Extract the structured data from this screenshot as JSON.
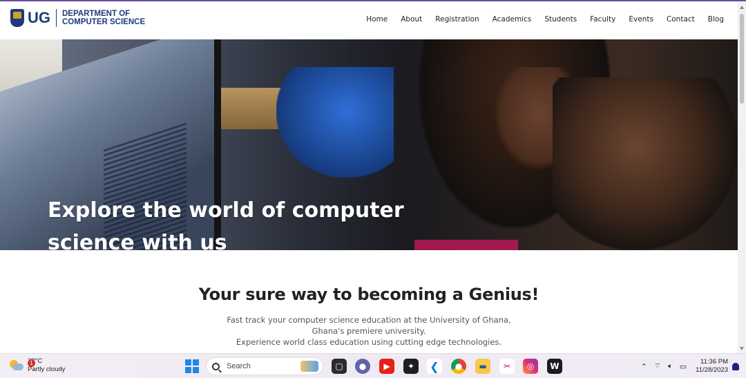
{
  "header": {
    "logo_text": "UG",
    "dept_line1": "DEPARTMENT OF",
    "dept_line2": "COMPUTER SCIENCE",
    "nav": [
      "Home",
      "About",
      "Registration",
      "Academics",
      "Students",
      "Faculty",
      "Events",
      "Contact",
      "Blog"
    ]
  },
  "hero": {
    "title": "Explore the world of computer science with us"
  },
  "intro": {
    "tagline": "Your sure way to becoming a Genius!",
    "line1": "Fast track your computer science education at the University of Ghana,",
    "line2": "Ghana's premiere university.",
    "line3": "Experience world class education using cutting edge technologies."
  },
  "taskbar": {
    "weather_temp": "28°C",
    "weather_desc": "Partly cloudy",
    "weather_badge": "1",
    "search_label": "Search",
    "apps": [
      "start-icon",
      "search-icon",
      "taskview-icon",
      "teams-icon",
      "youtube-icon",
      "figma-icon",
      "vscode-icon",
      "chrome-icon",
      "file-explorer-icon",
      "snipping-tool-icon",
      "instagram-icon",
      "webflow-icon"
    ],
    "time": "11:36 PM",
    "date": "11/28/2023"
  },
  "colors": {
    "brand": "#1f3a78",
    "accent_top": "#6a4aa0"
  }
}
